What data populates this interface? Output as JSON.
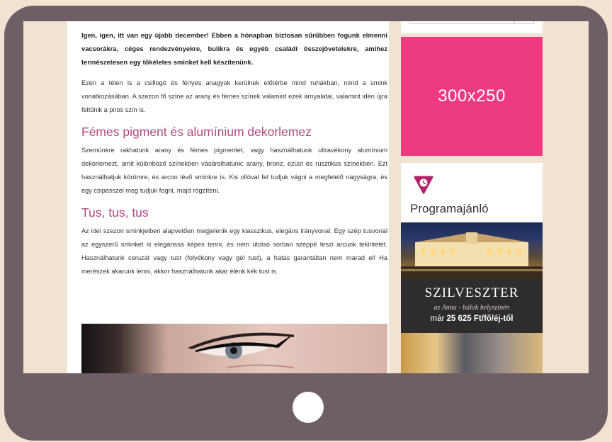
{
  "article": {
    "intro": "Igen, igen, itt van egy újabb december! Ebben a hónapban biztosan sűrűbben fogunk elmenni vacsorákra, céges rendezvényekre, bulikra és egyéb családi összejövetelekre, amihez természetesen egy tökéletes sminket kell készítenünk.",
    "paragraph_1": "Ezen a télen is a csillogó és fényes anagyok kerülnek előtérbe mind ruhákban, mind a smink vonatkozásában. A szezon fő színe az arany és fémes színek valamint ezek árnyalatai, valamint idén újra feltűnik a piros szín is.",
    "heading_1": "Fémes pigment és alumínium dekorlemez",
    "paragraph_2": "Szemünkre rakhatunk arany és fémes pigmentet, vagy használhatunk ultravékony alumínium dekorlemezt, amit különböző színekben vásárolhatunk: arany, bronz, ezüst és rusztikus színekben. Ezt használhatjuk körömre, és arcon lévő sminkre is. Kis ollóval fel tudjuk vágni a megfelelő nagyságra, és egy csipesszel meg tudjuk fogni, majd rögzíteni.",
    "heading_2": "Tus, tus, tus",
    "paragraph_3": "Az idei szezon sminkjeiben alapvetően megjelenik egy klasszikus, elegáns irányvonal. Egy szép tusvonal az egyszerű sminket is elegánssá képes tenni, és nem utolsó sorban széppé teszi arcunk tekintetét. Használhatunk ceruzát vagy tust (folyékony vagy gél tust), a hatás garantáltan nem marad el! Ha merészek akarunk lenni, akkor használhatunk akár élénk kék tust is."
  },
  "sidebar": {
    "ad_label": "300x250",
    "widget_title": "Programajánló",
    "widget_icon": "clock-triangle-icon",
    "event": {
      "title": "SZILVESZTER",
      "subtitle": "az Anna - bálok helyszínén",
      "price_prefix": "már ",
      "price_value": "25 625 Ft/fő/éj-től"
    }
  },
  "colors": {
    "device_frame": "#6e5f67",
    "page_background": "#f1e3d2",
    "heading_accent": "#b14880",
    "ad_background": "#ee3a81",
    "widget_icon": "#b0246a"
  }
}
